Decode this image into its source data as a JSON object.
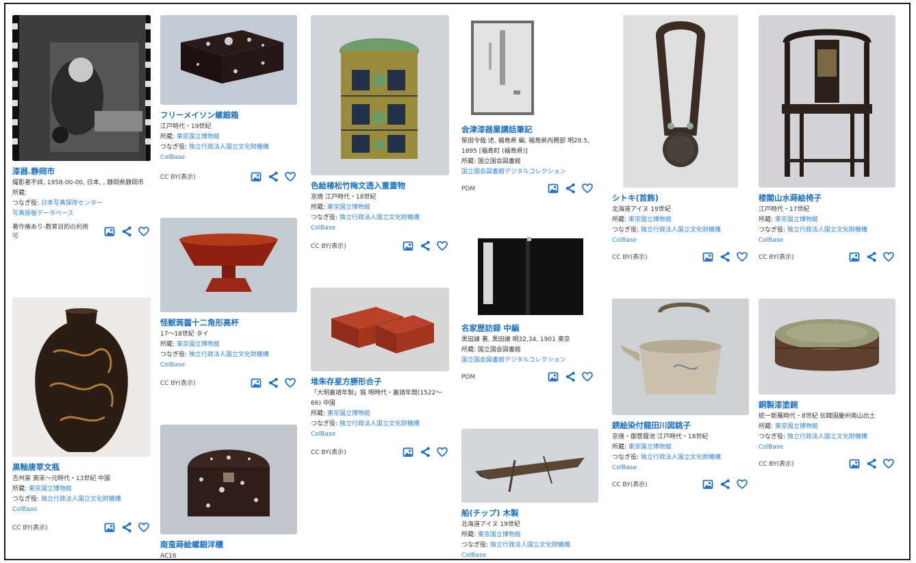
{
  "icons": {
    "image": "image-search-icon",
    "share": "share-icon",
    "favorite": "heart-icon"
  },
  "colors": {
    "link": "#1a6fc4",
    "accent": "#2d7ed6",
    "frame": "#1a1a1a"
  },
  "cards": [
    {
      "title": "漆器.静岡市",
      "line1": "撮影者不詳, 1958-00-00, 日本, , 静岡県静岡市",
      "owner_label": "所蔵:",
      "tsunagi_label": "つなぎ役:",
      "tsunagi_link": "日本写真保存センター",
      "collection": "写真原板データベース",
      "license": "著作権あり-教育目的の利用可"
    },
    {
      "title": "黒釉唐草文瓶",
      "line1": "吉州窯 南宋～元時代・13世紀 中国",
      "owner_label": "所蔵:",
      "owner_link": "東京国立博物館",
      "tsunagi_label": "つなぎ役:",
      "tsunagi_link": "独立行政法人国立文化財機構",
      "collection": "ColBase",
      "license": "CC BY(表示)"
    },
    {
      "title": "フリーメイソン螺鈿箱",
      "line1": "江戸時代・19世紀",
      "owner_label": "所蔵:",
      "owner_link": "東京国立博物館",
      "tsunagi_label": "つなぎ役:",
      "tsunagi_link": "独立行政法人国立文化財機構",
      "collection": "ColBase",
      "license": "CC BY(表示)"
    },
    {
      "title": "怪獣蒟醤十二角形高杯",
      "line1": "17～18世紀 タイ",
      "owner_label": "所蔵:",
      "owner_link": "東京国立博物館",
      "tsunagi_label": "つなぎ役:",
      "tsunagi_link": "独立行政法人国立文化財機構",
      "collection": "ColBase",
      "license": "CC BY(表示)"
    },
    {
      "title": "南蛮蒔絵螺鈿洋櫃",
      "line1": "AC16"
    },
    {
      "title": "色絵椿松竹梅文透入重蓋物",
      "line1": "京焼 江戸時代・18世紀",
      "owner_label": "所蔵:",
      "owner_link": "東京国立博物館",
      "tsunagi_label": "つなぎ役:",
      "tsunagi_link": "独立行政法人国立文化財機構",
      "collection": "ColBase",
      "license": "CC BY(表示)"
    },
    {
      "title": "堆朱存星方勝形合子",
      "line1": "「大明嘉靖年製」銘 明時代・嘉靖年間(1522～66) 中国",
      "owner_label": "所蔵:",
      "owner_link": "東京国立博物館",
      "tsunagi_label": "つなぎ役:",
      "tsunagi_link": "独立行政法人国立文化財機構",
      "collection": "ColBase",
      "license": "CC BY(表示)"
    },
    {
      "title": "会津漆器業講話筆記",
      "line1": "柴田令哉 述, 福島県 編, 福島県内務部 明28.5, 1895 [福島町 (福島県)]",
      "owner_label": "所蔵:",
      "owner_text": "国立国会図書館",
      "collection": "国立国会図書館デジタルコレクション",
      "license": "PDM"
    },
    {
      "title": "名家歴訪録 中編",
      "line1": "黒田譲 著, 黒田譲 明32,34, 1901 東京",
      "owner_label": "所蔵:",
      "owner_text": "国立国会図書館",
      "collection": "国立国会図書館デジタルコレクション",
      "license": "PDM"
    },
    {
      "title": "船(チップ) 木製",
      "line1": "北海道アイヌ 19世紀",
      "owner_label": "所蔵:",
      "owner_link": "東京国立博物館",
      "tsunagi_label": "つなぎ役:",
      "tsunagi_link": "独立行政法人国立文化財機構",
      "collection": "ColBase"
    },
    {
      "title": "シトキ(首飾)",
      "line1": "北海道アイヌ 19世紀",
      "owner_label": "所蔵:",
      "owner_link": "東京国立博物館",
      "tsunagi_label": "つなぎ役:",
      "tsunagi_link": "独立行政法人国立文化財機構",
      "collection": "ColBase",
      "license": "CC BY(表示)"
    },
    {
      "title": "銹絵染付龍田川図銚子",
      "line1": "京焼・御菩薩池 江戸時代・18世紀",
      "owner_label": "所蔵:",
      "owner_link": "東京国立博物館",
      "tsunagi_label": "つなぎ役:",
      "tsunagi_link": "独立行政法人国立文化財機構",
      "collection": "ColBase",
      "license": "CC BY(表示)"
    },
    {
      "title": "楼閣山水蒔絵椅子",
      "line1": "江戸時代・17世紀",
      "owner_label": "所蔵:",
      "owner_link": "東京国立博物館",
      "tsunagi_label": "つなぎ役:",
      "tsunagi_link": "独立行政法人国立文化財機構",
      "collection": "ColBase",
      "license": "CC BY(表示)"
    },
    {
      "title": "銅製漆塗鋺",
      "line1": "統一新羅時代・8世紀 伝韓国慶州南山出土",
      "owner_label": "所蔵:",
      "owner_link": "東京国立博物館",
      "tsunagi_label": "つなぎ役:",
      "tsunagi_link": "独立行政法人国立文化財機構",
      "collection": "ColBase",
      "license": "CC BY(表示)"
    }
  ]
}
